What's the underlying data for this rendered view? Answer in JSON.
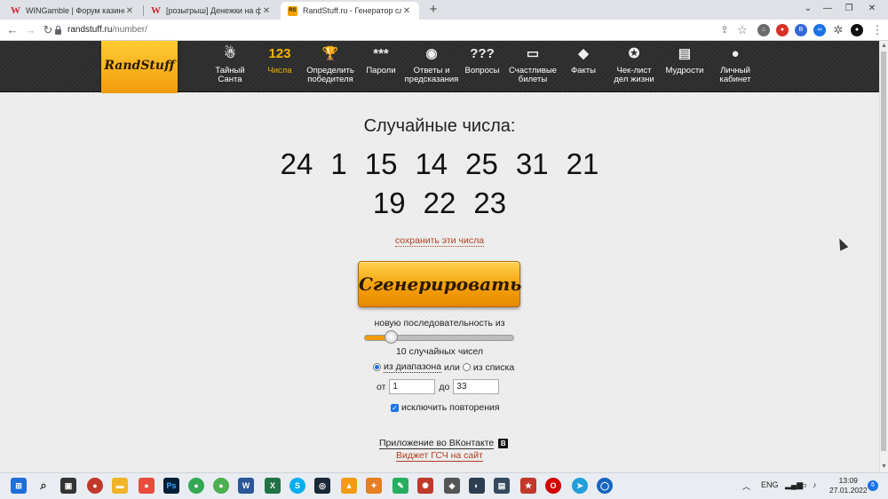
{
  "browser": {
    "tabs": [
      {
        "title": "WINGamble | Форум казино",
        "favicon": "W"
      },
      {
        "title": "[розыгрыш] Денежки на фарт",
        "favicon": "W"
      },
      {
        "title": "RandStuff.ru - Генератор случа",
        "favicon": "RS"
      }
    ],
    "url_host": "randstuff.ru",
    "url_path": "/number/"
  },
  "site": {
    "logo": "RandStuff",
    "menu": [
      {
        "label": "Тайный\nСанта",
        "icon": "santa-icon"
      },
      {
        "label": "Числа",
        "icon": "123",
        "active": true
      },
      {
        "label": "Определить\nпобедителя",
        "icon": "trophy-icon"
      },
      {
        "label": "Пароли",
        "icon": "***"
      },
      {
        "label": "Ответы и\nпредсказания",
        "icon": "magic-ball-icon"
      },
      {
        "label": "Вопросы",
        "icon": "???"
      },
      {
        "label": "Счастливые\nбилеты",
        "icon": "ticket-icon"
      },
      {
        "label": "Факты",
        "icon": "exclamation-icon"
      },
      {
        "label": "Чек-лист\nдел жизни",
        "icon": "checklist-icon"
      },
      {
        "label": "Мудрости",
        "icon": "scroll-icon"
      },
      {
        "label": "Личный\nкабинет",
        "icon": "user-icon"
      }
    ]
  },
  "main": {
    "title": "Случайные числа:",
    "numbers_row1": [
      "24",
      "1",
      "15",
      "14",
      "25",
      "31",
      "21"
    ],
    "numbers_row2": [
      "19",
      "22",
      "23"
    ],
    "save_link": "сохранить эти числа",
    "generate_button": "Сгенерировать",
    "sequence_label": "новую последовательность из",
    "slider_value_fraction": 0.18,
    "count_label": "10 случайных чисел",
    "from_range_label": "из диапазона",
    "or_label": "или",
    "from_list_label": "из списка",
    "from_label": "от",
    "from_value": "1",
    "to_label": "до",
    "to_value": "33",
    "exclude_repeats_label": "исключить повторения",
    "vk_app_link": "Приложение во ВКонтакте",
    "widget_link": "Виджет ГСЧ на сайт"
  },
  "taskbar": {
    "lang": "ENG",
    "time": "13:09",
    "date": "27.01.2022",
    "notifications": "6"
  },
  "colors": {
    "accent_orange": "#f29b0c",
    "header_dark": "#2c2c2c",
    "link_red": "#b04020"
  }
}
